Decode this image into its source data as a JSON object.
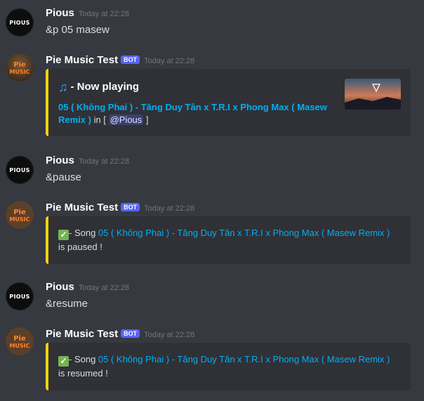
{
  "colors": {
    "background": "#36393f",
    "embed_bg": "#2f3136",
    "embed_accent": "#f1d313",
    "link": "#00aff4",
    "badge": "#5865f2"
  },
  "messages": [
    {
      "author": "Pious",
      "avatar_text": "PIOUS",
      "timestamp": "Today at 22:28",
      "content": "&p 05 masew"
    },
    {
      "author": "Pie Music Test",
      "badge": "BOT",
      "avatar_icon": "pie-music-logo-icon",
      "timestamp": "Today at 22:28",
      "embed": {
        "icon": "musical-note-icon",
        "title": "- Now playing",
        "song": "05 ( Không Phai ) - Tăng Duy Tân x T.R.I x Phong Max ( Masew Remix )",
        "in_text": " in [",
        "mention": "@Pious",
        "close": "]",
        "thumbnail": "song-thumbnail-image"
      }
    },
    {
      "author": "Pious",
      "avatar_text": "PIOUS",
      "timestamp": "Today at 22:28",
      "content": "&pause"
    },
    {
      "author": "Pie Music Test",
      "badge": "BOT",
      "timestamp": "Today at 22:28",
      "embed": {
        "icon": "check-mark-icon",
        "prefix": "- Song ",
        "song": "05 ( Không Phai ) - Tăng Duy Tân x T.R.I x Phong Max ( Masew Remix )",
        "suffix": " is paused !"
      }
    },
    {
      "author": "Pious",
      "avatar_text": "PIOUS",
      "timestamp": "Today at 22:28",
      "content": "&resume"
    },
    {
      "author": "Pie Music Test",
      "badge": "BOT",
      "timestamp": "Today at 22:28",
      "embed": {
        "icon": "check-mark-icon",
        "prefix": "- Song ",
        "song": "05 ( Không Phai ) - Tăng Duy Tân x T.R.I x Phong Max ( Masew Remix )",
        "suffix": " is resumed !"
      }
    }
  ]
}
